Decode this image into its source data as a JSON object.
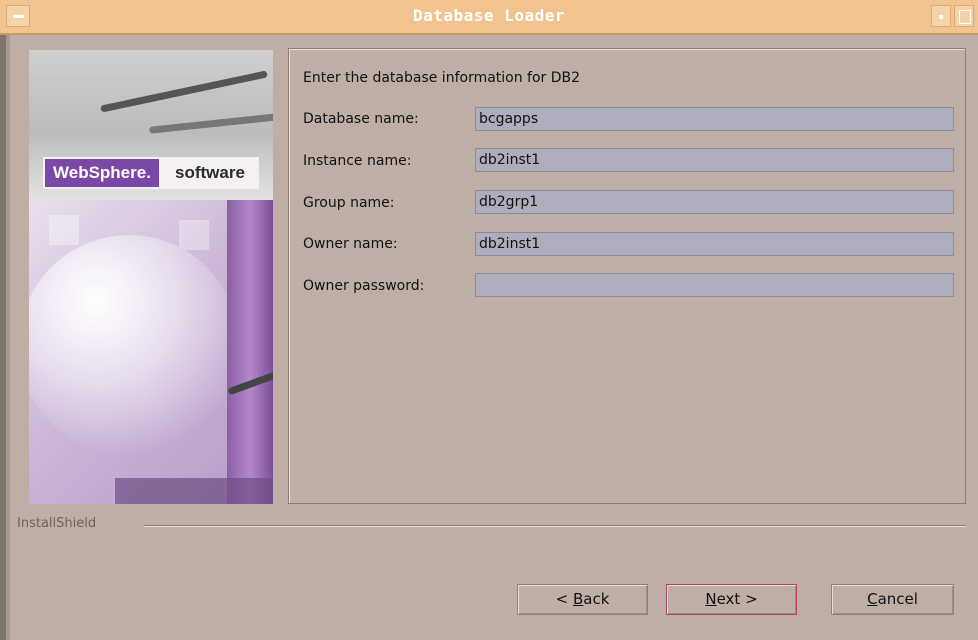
{
  "window": {
    "title": "Database Loader",
    "title_color": "#f1c38f"
  },
  "branding": {
    "product": "WebSphere.",
    "suffix": "software",
    "accent": "#7b49a5"
  },
  "form": {
    "heading": "Enter the database information for DB2",
    "fields": [
      {
        "label": "Database name:",
        "value": "bcgapps"
      },
      {
        "label": "Instance name:",
        "value": "db2inst1"
      },
      {
        "label": "Group name:",
        "value": "db2grp1"
      },
      {
        "label": "Owner name:",
        "value": "db2inst1"
      },
      {
        "label": "Owner password:",
        "value": ""
      }
    ]
  },
  "footer": {
    "brand": "InstallShield"
  },
  "buttons": {
    "back": {
      "prefix": "< ",
      "mnemonic": "B",
      "rest": "ack"
    },
    "next": {
      "mnemonic": "N",
      "rest": "ext >"
    },
    "cancel": {
      "mnemonic": "C",
      "rest": "ancel"
    }
  },
  "icons": [
    "window-menu-icon",
    "minimize-icon",
    "maximize-icon"
  ]
}
